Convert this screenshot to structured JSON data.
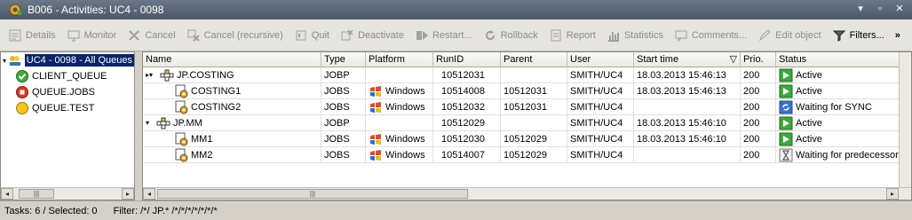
{
  "window": {
    "title": "B006 - Activities: UC4 - 0098"
  },
  "toolbar": {
    "buttons": [
      {
        "label": "Details",
        "icon": "details-icon",
        "enabled": false
      },
      {
        "label": "Monitor",
        "icon": "monitor-icon",
        "enabled": false
      },
      {
        "label": "Cancel",
        "icon": "cancel-icon",
        "enabled": false
      },
      {
        "label": "Cancel (recursive)",
        "icon": "cancel-recursive-icon",
        "enabled": false
      },
      {
        "label": "Quit",
        "icon": "quit-icon",
        "enabled": false
      },
      {
        "label": "Deactivate",
        "icon": "deactivate-icon",
        "enabled": false
      },
      {
        "label": "Restart...",
        "icon": "restart-icon",
        "enabled": false
      },
      {
        "label": "Rollback",
        "icon": "rollback-icon",
        "enabled": false
      },
      {
        "label": "Report",
        "icon": "report-icon",
        "enabled": false
      },
      {
        "label": "Statistics",
        "icon": "statistics-icon",
        "enabled": false
      },
      {
        "label": "Comments...",
        "icon": "comments-icon",
        "enabled": false
      },
      {
        "label": "Edit object",
        "icon": "edit-icon",
        "enabled": false
      },
      {
        "label": "Filters...",
        "icon": "filter-icon",
        "enabled": true
      }
    ],
    "overflow": "»"
  },
  "tree": {
    "items": [
      {
        "label": "UC4 - 0098 - All Queues",
        "icon": "queues-icon",
        "selected": true,
        "expanded": true
      },
      {
        "label": "CLIENT_QUEUE",
        "icon": "green-check-icon",
        "selected": false
      },
      {
        "label": "QUEUE.JOBS",
        "icon": "red-stop-icon",
        "selected": false
      },
      {
        "label": "QUEUE.TEST",
        "icon": "yellow-circle-icon",
        "selected": false
      }
    ]
  },
  "grid": {
    "columns": [
      "Name",
      "Type",
      "Platform",
      "RunID",
      "Parent",
      "User",
      "Start time",
      "Prio.",
      "Status"
    ],
    "rows": [
      {
        "marker": "▸▾",
        "name": "JP.COSTING",
        "icon": "workflow-icon",
        "type": "JOBP",
        "platform": "",
        "runid": "10512031",
        "parent": "",
        "user": "SMITH/UC4",
        "start": "18.03.2013 15:46:13",
        "prio": "200",
        "status": "Active",
        "status_icon": "active-icon"
      },
      {
        "marker": "",
        "name": "COSTING1",
        "icon": "job-icon",
        "type": "JOBS",
        "platform": "Windows",
        "runid": "10514008",
        "parent": "10512031",
        "user": "SMITH/UC4",
        "start": "18.03.2013 15:46:13",
        "prio": "200",
        "status": "Active",
        "status_icon": "active-icon"
      },
      {
        "marker": "",
        "name": "COSTING2",
        "icon": "job-icon",
        "type": "JOBS",
        "platform": "Windows",
        "runid": "10512032",
        "parent": "10512031",
        "user": "SMITH/UC4",
        "start": "",
        "prio": "200",
        "status": "Waiting for SYNC",
        "status_icon": "sync-icon"
      },
      {
        "marker": "▾",
        "name": "JP.MM",
        "icon": "workflow-icon",
        "type": "JOBP",
        "platform": "",
        "runid": "10512029",
        "parent": "",
        "user": "SMITH/UC4",
        "start": "18.03.2013 15:46:10",
        "prio": "200",
        "status": "Active",
        "status_icon": "active-icon"
      },
      {
        "marker": "",
        "name": "MM1",
        "icon": "job-icon",
        "type": "JOBS",
        "platform": "Windows",
        "runid": "10512030",
        "parent": "10512029",
        "user": "SMITH/UC4",
        "start": "18.03.2013 15:46:10",
        "prio": "200",
        "status": "Active",
        "status_icon": "active-icon"
      },
      {
        "marker": "",
        "name": "MM2",
        "icon": "job-icon",
        "type": "JOBS",
        "platform": "Windows",
        "runid": "10514007",
        "parent": "10512029",
        "user": "SMITH/UC4",
        "start": "",
        "prio": "200",
        "status": "Waiting for predecessor",
        "status_icon": "hourglass-icon"
      }
    ]
  },
  "statusbar": {
    "tasks": "Tasks: 6 / Selected: 0",
    "filter": "Filter: /*/ JP.* /*/*/*/*/*/*/*"
  }
}
